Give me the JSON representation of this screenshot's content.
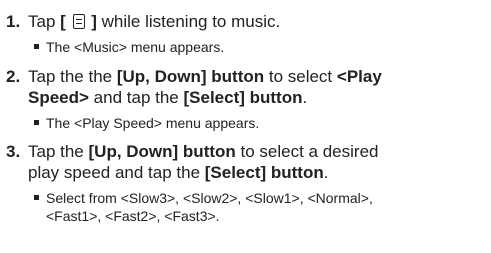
{
  "steps": [
    {
      "number": "1.",
      "parts": [
        "Tap ",
        "[ ",
        " ]",
        " while listening to music."
      ],
      "sub": "The <Music> menu appears."
    },
    {
      "number": "2.",
      "parts": [
        "Tap the the ",
        "[Up, Down] button",
        " to select ",
        "<Play",
        "Speed>",
        " and tap the ",
        "[Select] button",
        "."
      ],
      "sub": "The <Play Speed> menu appears."
    },
    {
      "number": "3.",
      "parts": [
        "Tap the ",
        "[Up, Down] button",
        " to select a desired",
        "play speed and tap the ",
        "[Select] button",
        "."
      ],
      "sub_line1": "Select from <Slow3>, <Slow2>, <Slow1>, <Normal>,",
      "sub_line2": "<Fast1>, <Fast2>, <Fast3>."
    }
  ],
  "icons": {
    "menu": "menu-icon"
  }
}
